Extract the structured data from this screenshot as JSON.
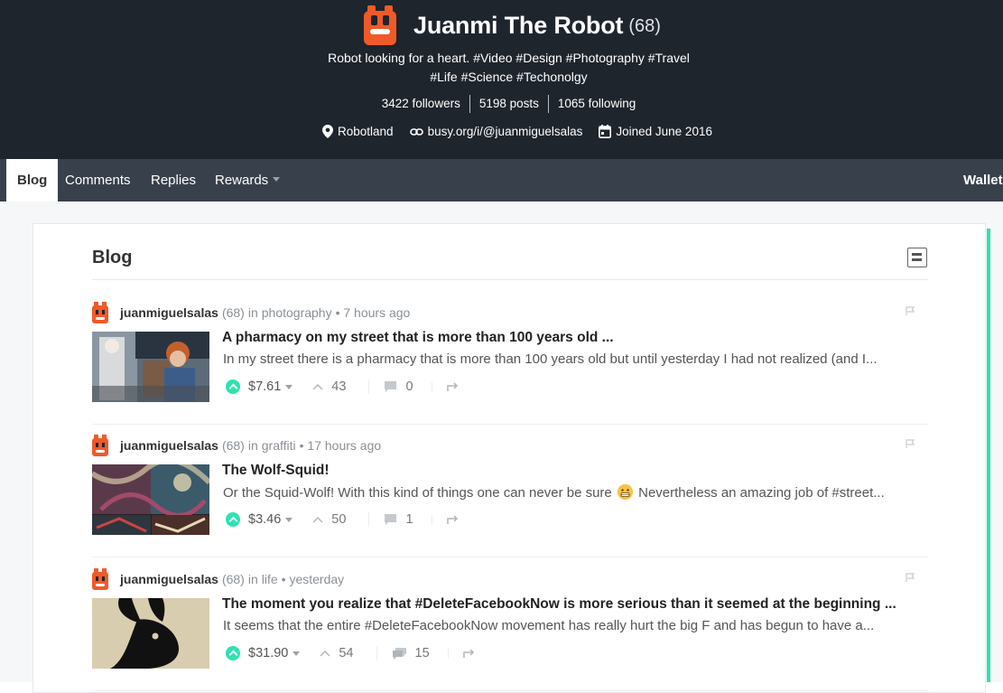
{
  "profile": {
    "name": "Juanmi The Robot",
    "reputation": "(68)",
    "bio_line1": "Robot looking for a heart. #Video #Design #Photography #Travel",
    "bio_line2": "#Life #Science #Techonolgy",
    "followers": "3422 followers",
    "posts": "5198 posts",
    "following": "1065 following",
    "location": "Robotland",
    "website": "busy.org/i/@juanmiguelsalas",
    "joined": "Joined June 2016",
    "avatar_color": "#f05a28"
  },
  "nav": {
    "tabs": [
      "Blog",
      "Comments",
      "Replies",
      "Rewards"
    ],
    "active": "Blog",
    "wallet": "Wallet"
  },
  "feed": {
    "title": "Blog",
    "accent_color": "#2ce3b1",
    "posts": [
      {
        "author": "juanmiguelsalas",
        "rep": "(68)",
        "in_label": "in",
        "category": "photography",
        "time": "• 7 hours ago",
        "title": "A pharmacy on my street that is more than 100 years old ...",
        "excerpt": "In my street there is a pharmacy that is more than 100 years old but until yesterday I had not realized (and I...",
        "payout": "$7.61",
        "likes": "43",
        "comments": "0"
      },
      {
        "author": "juanmiguelsalas",
        "rep": "(68)",
        "in_label": "in",
        "category": "graffiti",
        "time": "• 17 hours ago",
        "title": "The Wolf-Squid!",
        "excerpt_before": "Or the Squid-Wolf! With this kind of things one can never be sure",
        "excerpt_after": "Nevertheless an amazing job of #street...",
        "payout": "$3.46",
        "likes": "50",
        "comments": "1"
      },
      {
        "author": "juanmiguelsalas",
        "rep": "(68)",
        "in_label": "in",
        "category": "life",
        "time": "• yesterday",
        "title": "The moment you realize that #DeleteFacebookNow is more serious than it seemed at the beginning ...",
        "excerpt": "It seems that the entire #DeleteFacebookNow movement has really hurt the big F and has begun to have a...",
        "payout": "$31.90",
        "likes": "54",
        "comments": "15"
      }
    ]
  }
}
